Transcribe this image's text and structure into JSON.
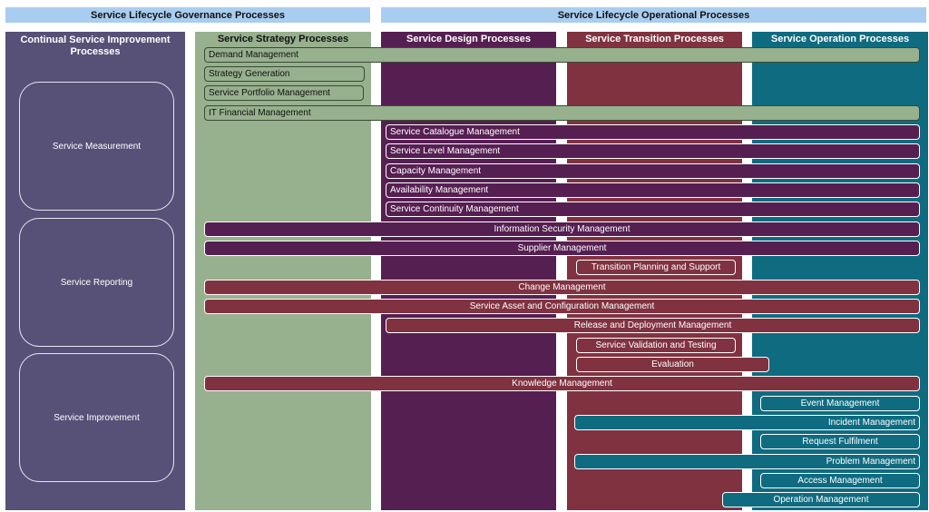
{
  "headers": {
    "governance": "Service Lifecycle Governance Processes",
    "operational": "Service Lifecycle Operational Processes"
  },
  "columns": {
    "csi": "Continual Service Improvement Processes",
    "strategy": "Service Strategy Processes",
    "design": "Service Design Processes",
    "transition": "Service Transition Processes",
    "operation": "Service Operation Processes"
  },
  "csi_items": [
    "Service Measurement",
    "Service Reporting",
    "Service Improvement"
  ],
  "processes": {
    "demand": "Demand Management",
    "strategy_generation": "Strategy Generation",
    "portfolio": "Service Portfolio Management",
    "financial": "IT Financial Management",
    "catalogue": "Service Catalogue Management",
    "level": "Service Level Management",
    "capacity": "Capacity Management",
    "availability": "Availability Management",
    "continuity": "Service Continuity Management",
    "security": "Information Security Management",
    "supplier": "Supplier Management",
    "transition_planning": "Transition Planning and Support",
    "change": "Change Management",
    "asset_config": "Service Asset and Configuration Management",
    "release": "Release and Deployment Management",
    "validation": "Service Validation and Testing",
    "evaluation": "Evaluation",
    "knowledge": "Knowledge Management",
    "event": "Event Management",
    "incident": "Incident Management",
    "request": "Request Fulfilment",
    "problem": "Problem Management",
    "access": "Access Management",
    "operation_mgmt": "Operation Management"
  },
  "colors": {
    "header_bg": "#a9cdf0",
    "csi": "#575077",
    "strategy": "#97b08d",
    "design": "#561f52",
    "transition": "#803240",
    "operation": "#0f6b80"
  }
}
